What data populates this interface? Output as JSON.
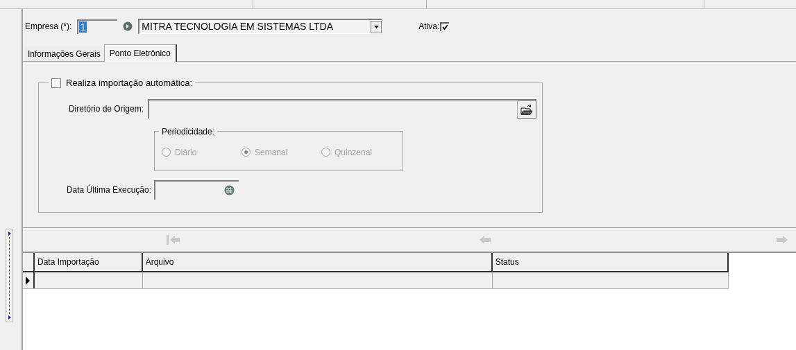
{
  "company": {
    "label": "Empresa (*):",
    "code": "1",
    "name": "MITRA TECNOLOGIA EM SISTEMAS LTDA",
    "active_label": "Ativa:",
    "active": true
  },
  "tabs": [
    {
      "label": "Informações Gerais",
      "selected": false
    },
    {
      "label": "Ponto Eletrônico",
      "selected": true
    }
  ],
  "auto_import": {
    "label": "Realiza importação automática:",
    "checked": false,
    "directory_label": "Diretório de Origem:",
    "last_run_label": "Data Última Execução:",
    "periodicity": {
      "label": "Periodicidade:",
      "disabled": true,
      "options": [
        {
          "label": "Diário",
          "selected": false
        },
        {
          "label": "Semanal",
          "selected": true
        },
        {
          "label": "Quinzenal",
          "selected": false
        }
      ]
    }
  },
  "grid": {
    "columns": [
      "Data Importação",
      "Arquivo",
      "Status"
    ],
    "rows": [
      {
        "selected": true
      }
    ]
  }
}
